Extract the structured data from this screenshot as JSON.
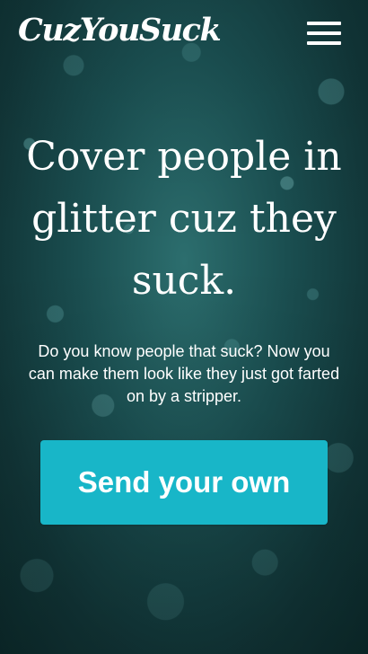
{
  "header": {
    "logo_text": "CuzYouSuck",
    "menu_icon": "hamburger-menu-icon"
  },
  "hero": {
    "headline": "Cover people in glitter cuz they suck.",
    "subtext": "Do you know people that suck? Now you can make them look like they just got farted on by a stripper."
  },
  "cta": {
    "label": "Send your own"
  },
  "colors": {
    "background": "#123c3e",
    "cta_background": "#18b6c8",
    "text": "#ffffff"
  }
}
